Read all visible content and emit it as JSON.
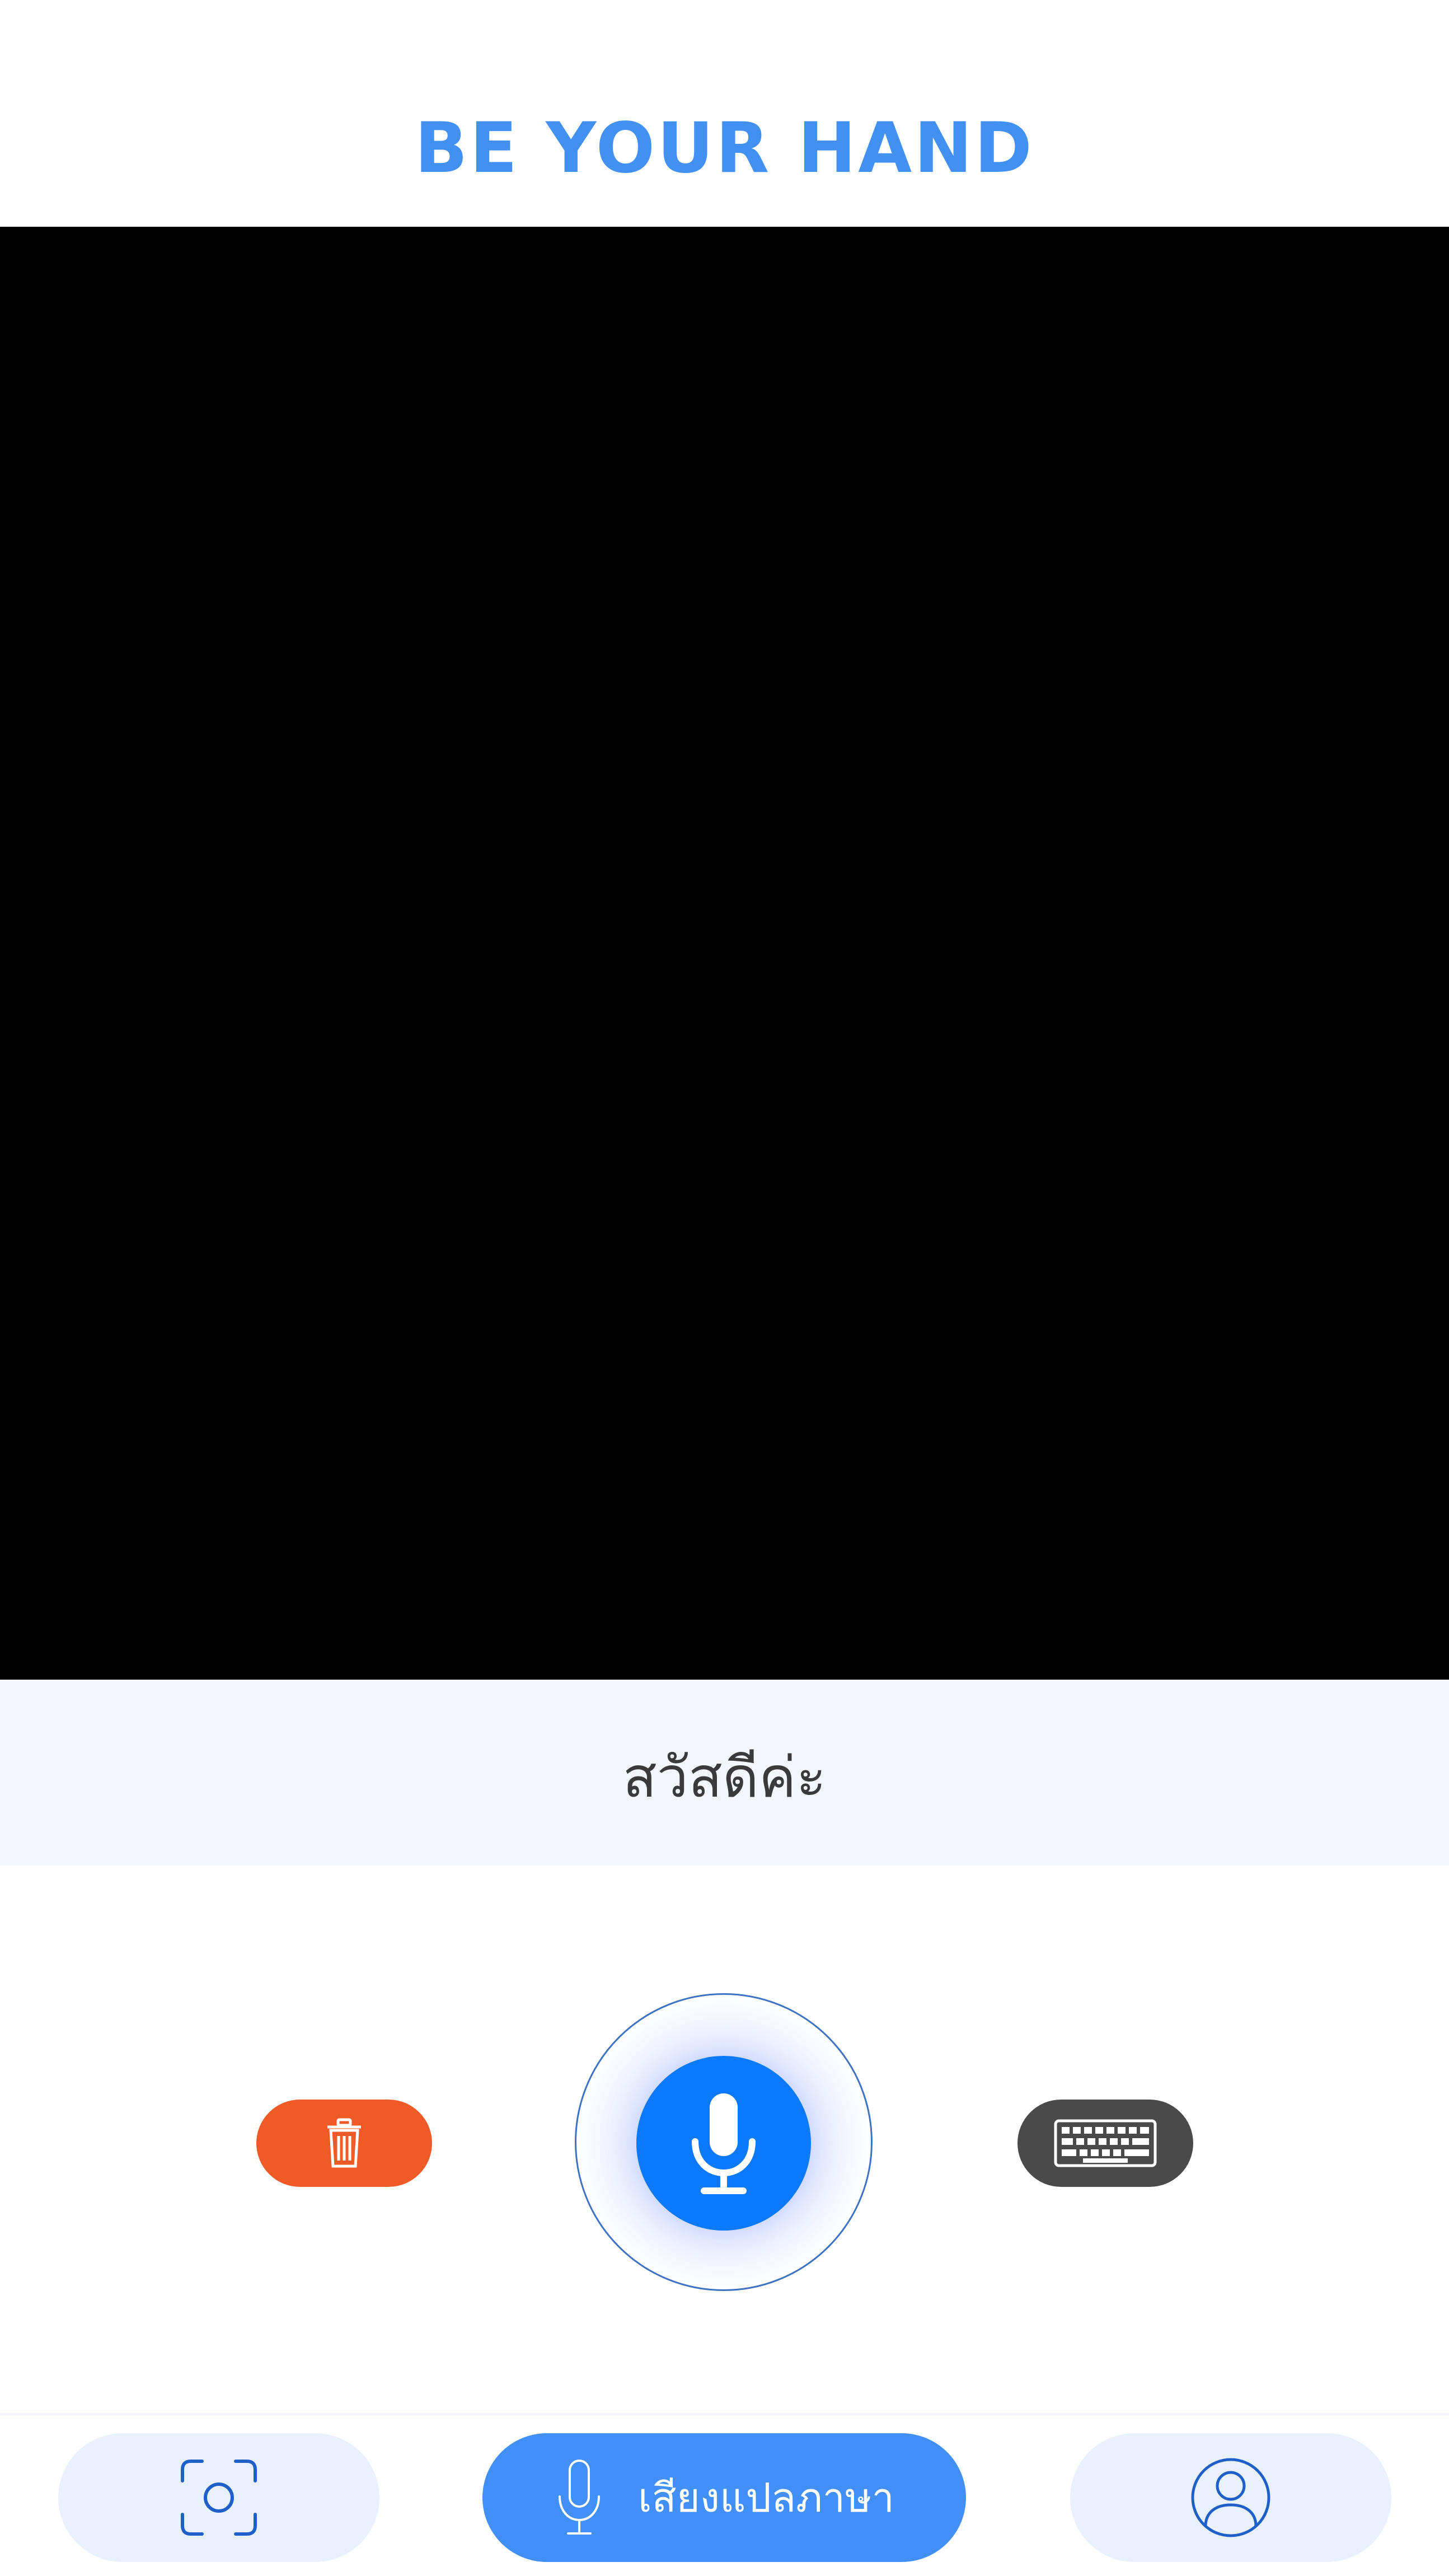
{
  "header": {
    "title": "BE YOUR HAND"
  },
  "camera": {
    "background": "#000000"
  },
  "transcript": {
    "text": "สวัสดีค่ะ"
  },
  "controls": {
    "delete_icon": "trash-icon",
    "mic_icon": "microphone-icon",
    "keyboard_icon": "keyboard-icon",
    "colors": {
      "delete": "#ef5a26",
      "mic": "#0a79fb",
      "keyboard": "#4a4a4a"
    }
  },
  "bottom_nav": {
    "items": [
      {
        "icon": "camera-focus-icon"
      },
      {
        "icon": "microphone-icon",
        "label": "เสียงแปลภาษา"
      },
      {
        "icon": "user-profile-icon"
      }
    ],
    "colors": {
      "active": "#4290f7",
      "inactive": "#e8f1fd",
      "icon": "#1f5fc9"
    }
  }
}
